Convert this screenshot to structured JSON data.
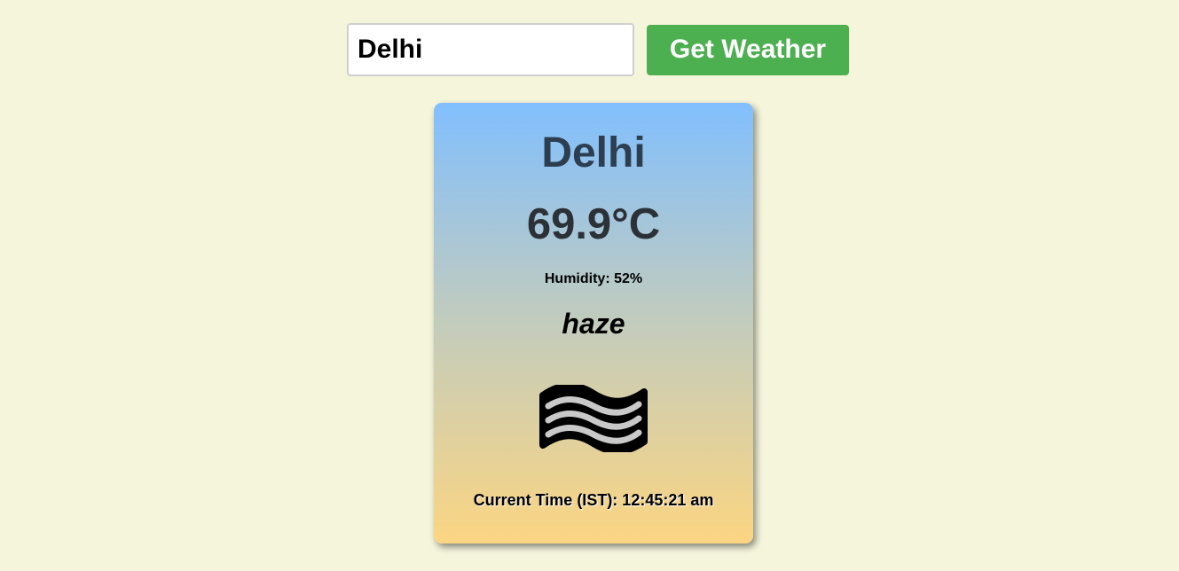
{
  "search": {
    "input_value": "Delhi",
    "button_label": "Get Weather"
  },
  "weather": {
    "city": "Delhi",
    "temperature": "69.9°C",
    "humidity": "Humidity: 52%",
    "condition": "haze",
    "icon": "haze-icon",
    "current_time": "Current Time (IST): 12:45:21 am"
  },
  "colors": {
    "page_background": "#f5f5dc",
    "button_background": "#4caf50",
    "card_gradient_top": "#81bffe",
    "card_gradient_bottom": "#fbd582"
  }
}
